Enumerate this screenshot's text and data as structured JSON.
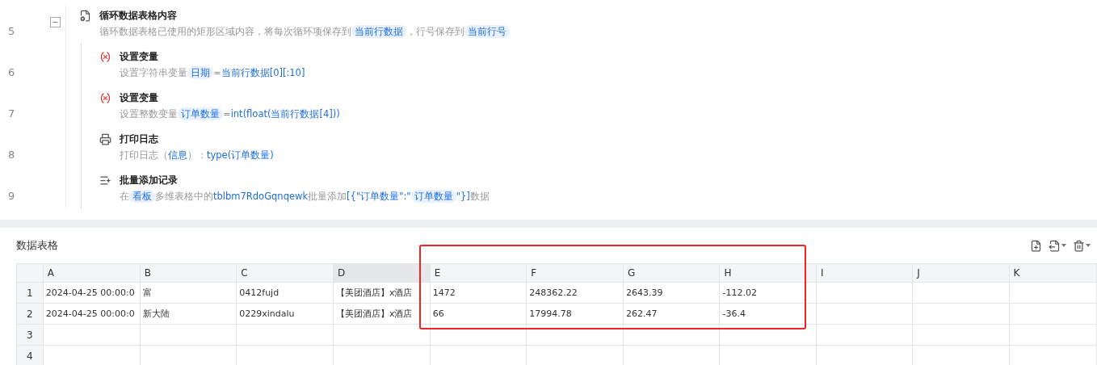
{
  "steps": [
    {
      "number": "5",
      "kind": "loop",
      "expanded": true,
      "title": "循环数据表格内容",
      "description": [
        {
          "kind": "text",
          "text": "循环数据表格已使用的矩形区域内容，将每次循环项保存到"
        },
        {
          "kind": "tag",
          "text": "当前行数据"
        },
        {
          "kind": "text",
          "text": "，行号保存到"
        },
        {
          "kind": "tag",
          "text": "当前行号"
        }
      ],
      "children": [
        {
          "number": "6",
          "kind": "variable",
          "title": "设置变量",
          "description": [
            {
              "kind": "text",
              "text": "设置字符串变量"
            },
            {
              "kind": "tag",
              "text": "日期"
            },
            {
              "kind": "text",
              "text": "="
            },
            {
              "kind": "expr",
              "text": "当前行数据[0][:10]"
            }
          ]
        },
        {
          "number": "7",
          "kind": "variable",
          "title": "设置变量",
          "description": [
            {
              "kind": "text",
              "text": "设置整数变量"
            },
            {
              "kind": "tag",
              "text": "订单数量"
            },
            {
              "kind": "text",
              "text": "="
            },
            {
              "kind": "expr",
              "text": "int(float(当前行数据[4]))"
            }
          ]
        },
        {
          "number": "8",
          "kind": "log",
          "title": "打印日志",
          "description": [
            {
              "kind": "text",
              "text": "打印日志（"
            },
            {
              "kind": "expr",
              "text": "信息"
            },
            {
              "kind": "text",
              "text": "）："
            },
            {
              "kind": "expr",
              "text": "type(订单数量)"
            }
          ]
        },
        {
          "number": "9",
          "kind": "batch",
          "title": "批量添加记录",
          "description": [
            {
              "kind": "text",
              "text": "在"
            },
            {
              "kind": "tag",
              "text": "看板"
            },
            {
              "kind": "text",
              "text": "多维表格中的"
            },
            {
              "kind": "expr",
              "text": "tblbm7RdoGqnqewk"
            },
            {
              "kind": "text",
              "text": "批量添加"
            },
            {
              "kind": "expr",
              "text": "[{\"订单数量\":\""
            },
            {
              "kind": "tag",
              "text": "订单数量"
            },
            {
              "kind": "expr",
              "text": "\"}]"
            },
            {
              "kind": "text",
              "text": "数据"
            }
          ]
        }
      ]
    }
  ],
  "panel": {
    "title": "数据表格",
    "table": {
      "columns": [
        {
          "label": "A",
          "selected": false
        },
        {
          "label": "B",
          "selected": false
        },
        {
          "label": "C",
          "selected": false
        },
        {
          "label": "D",
          "selected": true
        },
        {
          "label": "E",
          "selected": false
        },
        {
          "label": "F",
          "selected": false
        },
        {
          "label": "G",
          "selected": false
        },
        {
          "label": "H",
          "selected": false
        },
        {
          "label": "I",
          "selected": false
        },
        {
          "label": "J",
          "selected": false
        },
        {
          "label": "K",
          "selected": false
        }
      ],
      "rows": [
        {
          "number": "1",
          "cells": [
            "2024-04-25 00:00:0",
            "富",
            "0412fujd",
            "【美团酒店】x酒店",
            "1472",
            "248362.22",
            "2643.39",
            "-112.02",
            "",
            "",
            ""
          ]
        },
        {
          "number": "2",
          "cells": [
            "2024-04-25 00:00:0",
            "新大陆",
            "0229xindalu",
            "【美团酒店】x酒店",
            "66",
            "17994.78",
            "262.47",
            "-36.4",
            "",
            "",
            ""
          ]
        },
        {
          "number": "3",
          "cells": [
            "",
            "",
            "",
            "",
            "",
            "",
            "",
            "",
            "",
            "",
            ""
          ]
        },
        {
          "number": "4",
          "cells": [
            "",
            "",
            "",
            "",
            "",
            "",
            "",
            "",
            "",
            "",
            ""
          ]
        }
      ]
    }
  }
}
